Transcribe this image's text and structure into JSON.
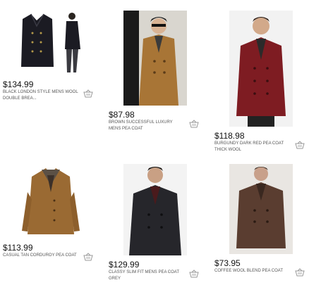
{
  "products": [
    {
      "price": "$134.99",
      "name": "BLACK LONDON STYLE MENS WOOL DOUBLE BREA...",
      "color": "#1b1b23"
    },
    {
      "price": "$87.98",
      "name": "BROWN SUCCESSFUL LUXURY MENS PEA COAT",
      "color": "#a87536"
    },
    {
      "price": "$118.98",
      "name": "BURGUNDY DARK RED PEA COAT THICK WOOL",
      "color": "#7e1c22"
    },
    {
      "price": "$113.99",
      "name": "CASUAL TAN CORDUROY PEA COAT",
      "color": "#9a6a33"
    },
    {
      "price": "$129.99",
      "name": "CLASSY SLIM FIT MENS PEA COAT GREY",
      "color": "#26262b"
    },
    {
      "price": "$73.95",
      "name": "COFFEE WOOL BLEND PEA COAT",
      "color": "#5a3d30"
    }
  ],
  "icons": {
    "cart": "shopping-basket-icon"
  }
}
